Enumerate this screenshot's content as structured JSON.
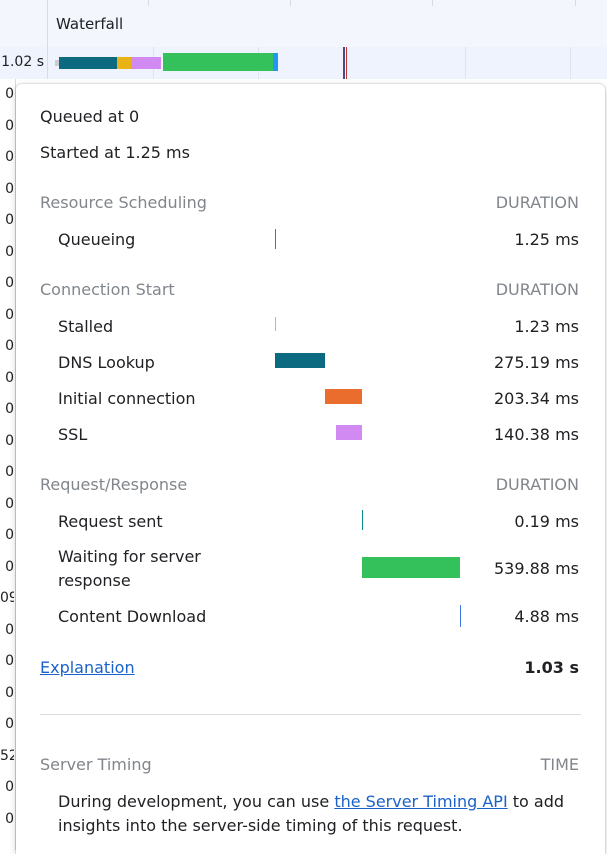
{
  "header": {
    "title": "Waterfall"
  },
  "row": {
    "time": "1.02 s"
  },
  "left_column": [
    "0",
    "0",
    "0",
    "0",
    "0",
    "0",
    "0",
    "0",
    "0",
    "0",
    "0",
    "0",
    "0",
    "0",
    "0",
    "0",
    "09",
    "0",
    "0",
    "0",
    "0",
    "52",
    "0",
    "0"
  ],
  "popover": {
    "queued": "Queued at 0",
    "started": "Started at 1.25 ms",
    "sections": {
      "resource_scheduling": {
        "title": "Resource Scheduling",
        "col": "DURATION",
        "rows": [
          {
            "label": "Queueing",
            "value": "1.25 ms"
          }
        ]
      },
      "connection_start": {
        "title": "Connection Start",
        "col": "DURATION",
        "rows": [
          {
            "label": "Stalled",
            "value": "1.23 ms"
          },
          {
            "label": "DNS Lookup",
            "value": "275.19 ms"
          },
          {
            "label": "Initial connection",
            "value": "203.34 ms"
          },
          {
            "label": "SSL",
            "value": "140.38 ms"
          }
        ]
      },
      "request_response": {
        "title": "Request/Response",
        "col": "DURATION",
        "rows": [
          {
            "label": "Request sent",
            "value": "0.19 ms"
          },
          {
            "label": "Waiting for server",
            "label2": "response",
            "value": "539.88 ms"
          },
          {
            "label": "Content Download",
            "value": "4.88 ms"
          }
        ]
      }
    },
    "explanation": "Explanation",
    "total": "1.03 s",
    "server_timing": {
      "title": "Server Timing",
      "col": "TIME",
      "text_before": "During development, you can use ",
      "link": "the Server Timing API",
      "text_after": " to add insights into the server-side timing of this request."
    }
  },
  "colors": {
    "queueing": "#6b6b6b",
    "dns": "#0b6a80",
    "connection": "#ea6d2e",
    "ssl": "#d08af2",
    "request_sent": "#0b8a8a",
    "waiting": "#34c05a",
    "download": "#3b7be0",
    "link": "#1a62c9"
  }
}
